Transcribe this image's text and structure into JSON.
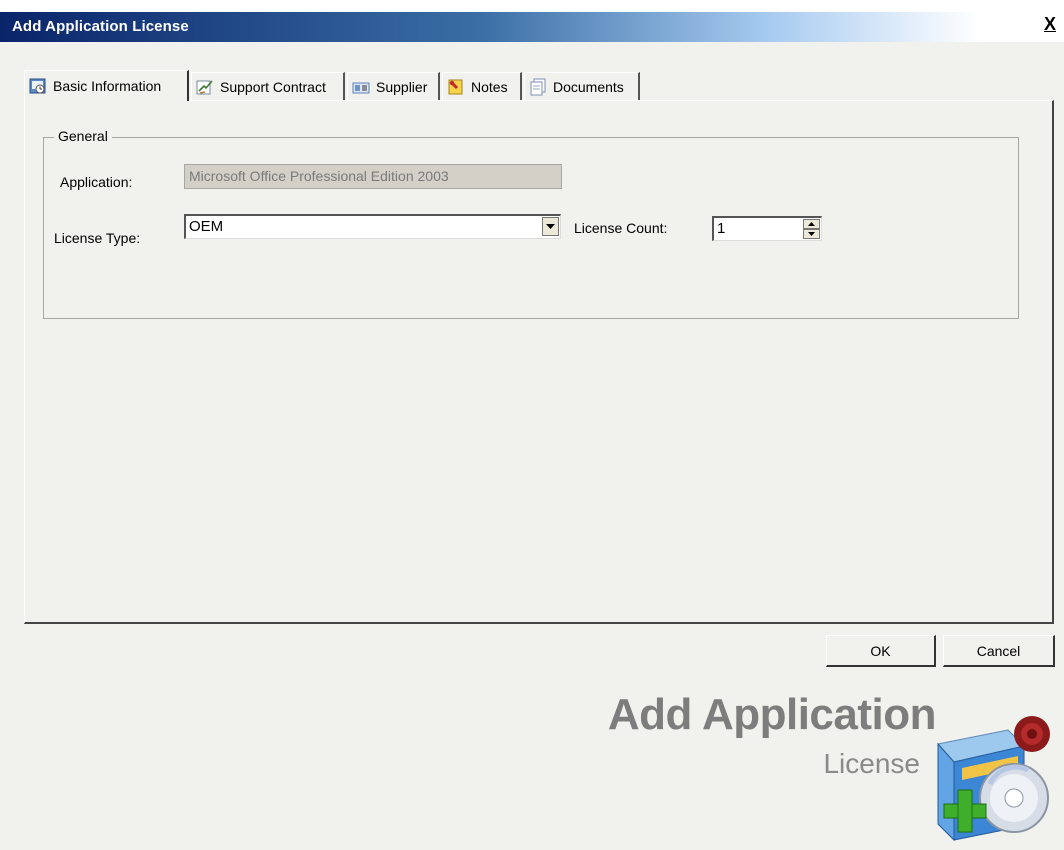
{
  "window": {
    "title": "Add Application License",
    "close_glyph": "X"
  },
  "tabs": [
    {
      "label": "Basic Information",
      "icon": "basic-info-icon",
      "active": true
    },
    {
      "label": "Support Contract",
      "icon": "support-contract-icon",
      "active": false
    },
    {
      "label": "Supplier",
      "icon": "supplier-icon",
      "active": false
    },
    {
      "label": "Notes",
      "icon": "notes-icon",
      "active": false
    },
    {
      "label": "Documents",
      "icon": "documents-icon",
      "active": false
    }
  ],
  "general": {
    "legend": "General",
    "application_label": "Application:",
    "application_value": "Microsoft Office Professional Edition 2003",
    "license_type_label": "License Type:",
    "license_type_value": "OEM",
    "license_count_label": "License Count:",
    "license_count_value": "1"
  },
  "buttons": {
    "ok": "OK",
    "cancel": "Cancel"
  },
  "branding": {
    "title": "Add Application",
    "subtitle": "License",
    "icon": "add-license-box-icon"
  },
  "colors": {
    "titlebar_start": "#0a246a",
    "dialog_bg": "#f1f1ed",
    "disabled_field_bg": "#d4d0c8",
    "brand_text": "#7d7d7d"
  }
}
